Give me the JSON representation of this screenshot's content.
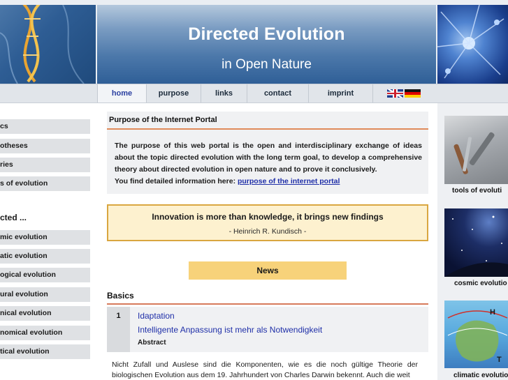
{
  "header": {
    "title": "Directed Evolution",
    "subtitle": "in Open Nature"
  },
  "nav": {
    "items": [
      {
        "label": "home",
        "active": true
      },
      {
        "label": "purpose",
        "active": false
      },
      {
        "label": "links",
        "active": false
      },
      {
        "label": "contact",
        "active": false
      },
      {
        "label": "imprint",
        "active": false
      }
    ],
    "languages": [
      "english-flag-icon",
      "german-flag-icon"
    ]
  },
  "sidebar": {
    "items_top": [
      "cs",
      "otheses",
      "ries",
      "s of evolution"
    ],
    "heading": "cted ...",
    "items_bottom": [
      "mic evolution",
      "atic evolution",
      "ogical evolution",
      "ural evolution",
      "nical evolution",
      "nomical evolution",
      "tical evolution"
    ]
  },
  "portal": {
    "title": "Purpose of the Internet Portal",
    "text": "The purpose of this web portal is the open and interdisciplinary exchange of ideas about the topic directed evolution with the long term goal, to develop a comprehensive theory about directed evolution in open nature and to prove it conclusively.",
    "more_prefix": "You find detailed information here: ",
    "more_link": "purpose of the internet portal"
  },
  "quote": {
    "text": "Innovation is more than knowledge, it brings new findings",
    "author": "- Heinrich R. Kundisch -"
  },
  "news": {
    "label": "News"
  },
  "basics": {
    "title": "Basics",
    "article": {
      "number": "1",
      "tag": "Idaptation",
      "title": "Intelligente Anpassung ist mehr als Notwendigkeit",
      "abstract_label": "Abstract"
    },
    "body": "Nicht Zufall und Auslese sind die Komponenten, wie es die noch gültige Theorie der biologischen Evolution aus dem 19. Jahrhundert von Charles Darwin bekennt. Auch die weit"
  },
  "right": {
    "thumbs": [
      {
        "label": "tools of evoluti"
      },
      {
        "label": "cosmic evolutio"
      },
      {
        "label": "climatic evolutio"
      }
    ]
  },
  "colors": {
    "header_blue": "#2f5f97",
    "nav_active": "#2a3fa0",
    "link_blue": "#1f2fa8",
    "accent_orange": "#e08a5a",
    "quote_border": "#d9a640",
    "news_bg": "#f7d27a"
  }
}
